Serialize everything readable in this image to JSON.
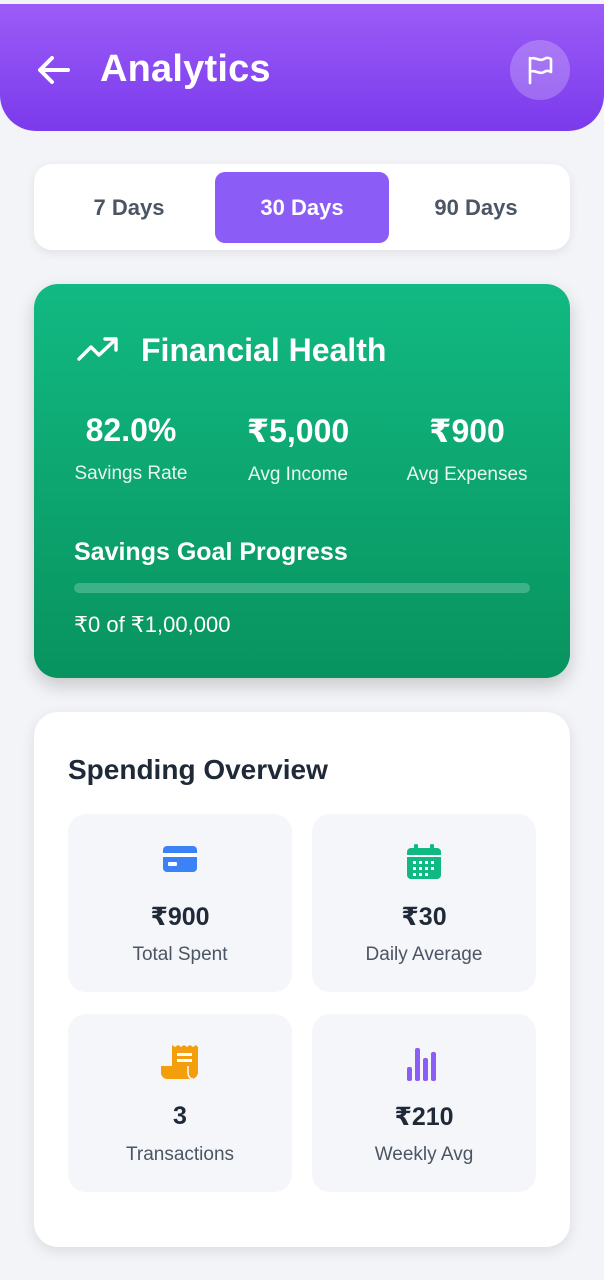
{
  "header": {
    "title": "Analytics"
  },
  "tabs": [
    "7 Days",
    "30 Days",
    "90 Days"
  ],
  "active_tab": "30 Days",
  "financial_health": {
    "title": "Financial Health",
    "stats": [
      {
        "value": "82.0%",
        "label": "Savings Rate"
      },
      {
        "value": "₹5,000",
        "label": "Avg Income"
      },
      {
        "value": "₹900",
        "label": "Avg Expenses"
      }
    ],
    "goal_title": "Savings Goal Progress",
    "goal_progress": 0,
    "goal_text": "₹0 of ₹1,00,000"
  },
  "spending_overview": {
    "title": "Spending Overview",
    "tiles": [
      {
        "icon": "credit-card-icon",
        "value": "₹900",
        "label": "Total Spent",
        "color": "#3b82f6"
      },
      {
        "icon": "calendar-icon",
        "value": "₹30",
        "label": "Daily Average",
        "color": "#10b981"
      },
      {
        "icon": "receipt-icon",
        "value": "3",
        "label": "Transactions",
        "color": "#f59e0b"
      },
      {
        "icon": "bar-chart-icon",
        "value": "₹210",
        "label": "Weekly Avg",
        "color": "#8b5cf6"
      }
    ]
  },
  "colors": {
    "header": "#8b5cf6",
    "health_card": "#10b981",
    "active_tab": "#8b5cf6"
  }
}
